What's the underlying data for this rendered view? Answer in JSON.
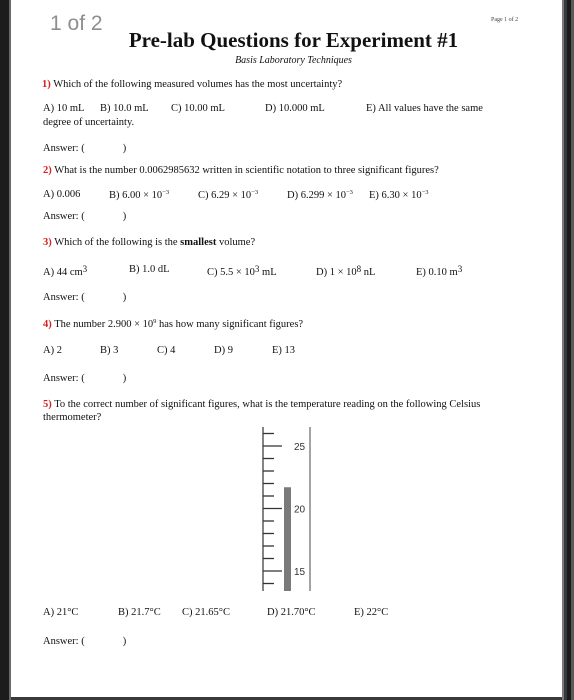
{
  "viewer": {
    "page_counter": "1 of 2"
  },
  "document": {
    "page_label": "Page 1 of 2",
    "title": "Pre-lab Questions for Experiment #1",
    "subtitle": "Basis Laboratory Techniques",
    "answer_label": "Answer: (",
    "answer_close": ")"
  },
  "questions": [
    {
      "number": "1)",
      "text": "Which of the following measured volumes has the most uncertainty?",
      "options": [
        {
          "label": "A) 10 mL"
        },
        {
          "label": "B) 10.0 mL"
        },
        {
          "label": "C) 10.00 mL"
        },
        {
          "label": "D) 10.000 mL"
        },
        {
          "label": "E) All values have the same"
        }
      ],
      "option_continuation": "degree of uncertainty."
    },
    {
      "number": "2)",
      "text": "What is the number 0.0062985632 written in scientific notation to three significant figures?",
      "options": [
        {
          "label": "A) 0.006",
          "exp": ""
        },
        {
          "label": "B) 6.00 × 10",
          "exp": "−3"
        },
        {
          "label": "C) 6.29 × 10",
          "exp": "−3"
        },
        {
          "label": "D) 6.299 × 10",
          "exp": "−3"
        },
        {
          "label": "E) 6.30 × 10",
          "exp": "−3"
        }
      ]
    },
    {
      "number": "3)",
      "text_before": "Which of the following is the ",
      "text_bold": "smallest",
      "text_after": " volume?",
      "options": [
        {
          "pre": "A) 44 cm",
          "sup": "3",
          "post": ""
        },
        {
          "pre": "B) 1.0 dL",
          "sup": "",
          "post": ""
        },
        {
          "pre": "C) 5.5 × 10",
          "sup": "3",
          "post": " mL"
        },
        {
          "pre": "D) 1 × 10",
          "sup": "8",
          "post": " nL"
        },
        {
          "pre": "E) 0.10 m",
          "sup": "3",
          "post": ""
        }
      ]
    },
    {
      "number": "4)",
      "text_before": "The number 2.900 × 10",
      "text_sup": "9",
      "text_after": " has how many significant figures?",
      "options": [
        {
          "label": "A) 2"
        },
        {
          "label": "B) 3"
        },
        {
          "label": "C) 4"
        },
        {
          "label": "D) 9"
        },
        {
          "label": "E) 13"
        }
      ]
    },
    {
      "number": "5)",
      "text": "To the correct number of significant figures, what is the temperature reading on the following Celsius",
      "text_line2": "thermometer?",
      "options": [
        {
          "label": "A) 21°C"
        },
        {
          "label": "B) 21.7°C"
        },
        {
          "label": "C) 21.65°C"
        },
        {
          "label": "D) 21.70°C"
        },
        {
          "label": "E) 22°C"
        }
      ],
      "thermometer": {
        "unit": "°C",
        "scale_min": 14,
        "scale_max": 26,
        "major_ticks": [
          25,
          20,
          15
        ],
        "minor_tick_step": 1,
        "reading": 21.7
      }
    }
  ]
}
